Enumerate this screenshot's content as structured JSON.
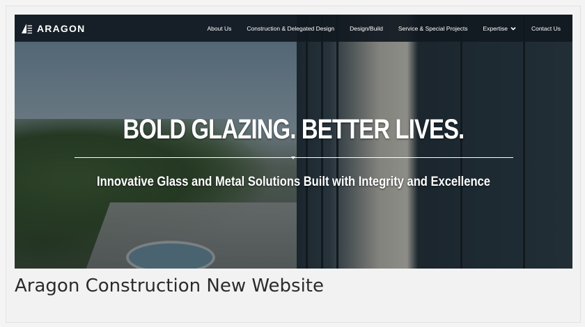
{
  "navbar": {
    "logo_text": "ARAGON",
    "items": [
      {
        "label": "About Us"
      },
      {
        "label": "Construction & Delegated Design"
      },
      {
        "label": "Design/Build"
      },
      {
        "label": "Service & Special Projects"
      },
      {
        "label": "Expertise"
      },
      {
        "label": "Contact Us"
      }
    ],
    "dropdown_icon": "chevron-down-icon"
  },
  "hero": {
    "headline": "BOLD GLAZING. BETTER LIVES.",
    "subheadline": "Innovative Glass and Metal Solutions Built with Integrity and Excellence"
  },
  "caption": "Aragon Construction New Website",
  "colors": {
    "navbar_bg": "#111921",
    "text_white": "#ffffff",
    "caption_text": "#2b2b2b"
  }
}
